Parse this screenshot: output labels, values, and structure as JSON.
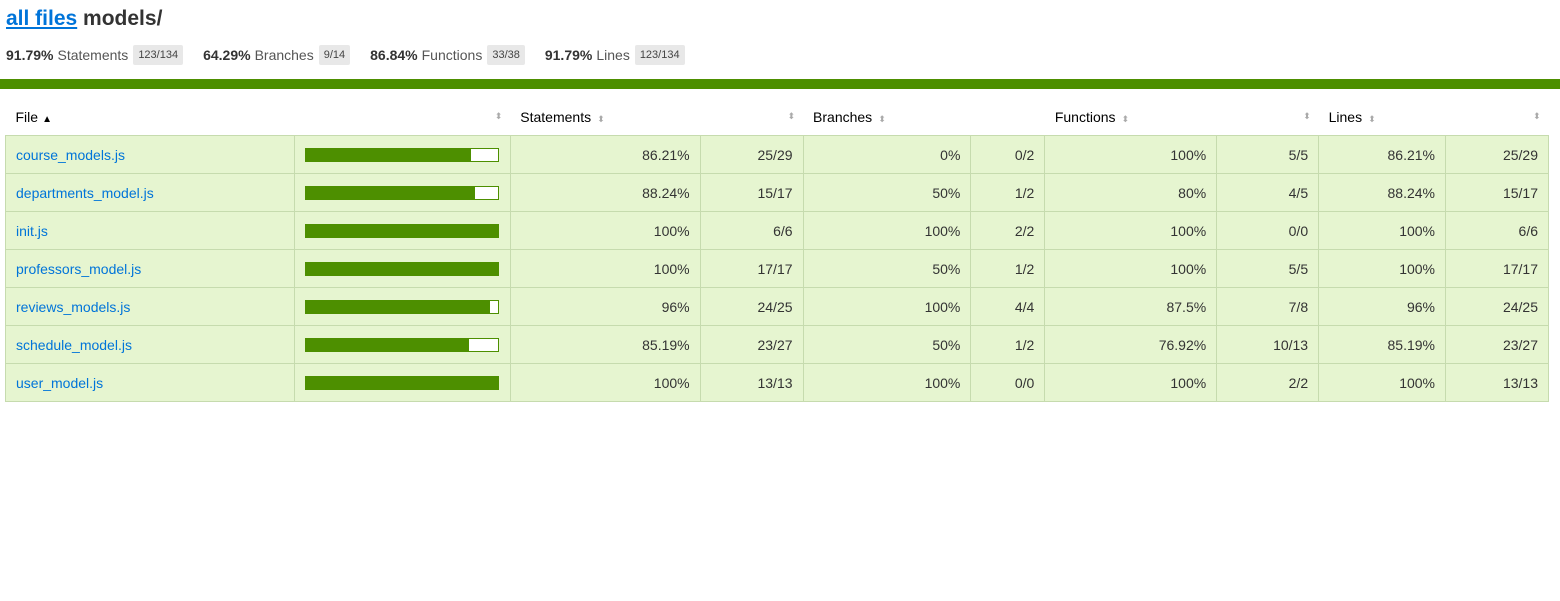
{
  "header": {
    "all_files_link": "all files",
    "current_dir": "models/"
  },
  "summary": [
    {
      "pct": "91.79%",
      "label": "Statements",
      "fraction": "123/134"
    },
    {
      "pct": "64.29%",
      "label": "Branches",
      "fraction": "9/14"
    },
    {
      "pct": "86.84%",
      "label": "Functions",
      "fraction": "33/38"
    },
    {
      "pct": "91.79%",
      "label": "Lines",
      "fraction": "123/134"
    }
  ],
  "table": {
    "headers": {
      "file": "File",
      "statements": "Statements",
      "branches": "Branches",
      "functions": "Functions",
      "lines": "Lines"
    },
    "sort_arrow": "▲",
    "sort_indicator": "⬍",
    "rows": [
      {
        "file": "course_models.js",
        "coverage": 0.8621,
        "statements_pct": "86.21%",
        "statements_frac": "25/29",
        "branches_pct": "0%",
        "branches_frac": "0/2",
        "functions_pct": "100%",
        "functions_frac": "5/5",
        "lines_pct": "86.21%",
        "lines_frac": "25/29",
        "stmt_level": "high",
        "branch_level": "low",
        "func_level": "high",
        "line_level": "high"
      },
      {
        "file": "departments_model.js",
        "coverage": 0.8824,
        "statements_pct": "88.24%",
        "statements_frac": "15/17",
        "branches_pct": "50%",
        "branches_frac": "1/2",
        "functions_pct": "80%",
        "functions_frac": "4/5",
        "lines_pct": "88.24%",
        "lines_frac": "15/17",
        "stmt_level": "high",
        "branch_level": "medium",
        "func_level": "high",
        "line_level": "high"
      },
      {
        "file": "init.js",
        "coverage": 1.0,
        "statements_pct": "100%",
        "statements_frac": "6/6",
        "branches_pct": "100%",
        "branches_frac": "2/2",
        "functions_pct": "100%",
        "functions_frac": "0/0",
        "lines_pct": "100%",
        "lines_frac": "6/6",
        "stmt_level": "high",
        "branch_level": "high",
        "func_level": "high",
        "line_level": "high"
      },
      {
        "file": "professors_model.js",
        "coverage": 1.0,
        "statements_pct": "100%",
        "statements_frac": "17/17",
        "branches_pct": "50%",
        "branches_frac": "1/2",
        "functions_pct": "100%",
        "functions_frac": "5/5",
        "lines_pct": "100%",
        "lines_frac": "17/17",
        "stmt_level": "high",
        "branch_level": "medium",
        "func_level": "high",
        "line_level": "high"
      },
      {
        "file": "reviews_models.js",
        "coverage": 0.96,
        "statements_pct": "96%",
        "statements_frac": "24/25",
        "branches_pct": "100%",
        "branches_frac": "4/4",
        "functions_pct": "87.5%",
        "functions_frac": "7/8",
        "lines_pct": "96%",
        "lines_frac": "24/25",
        "stmt_level": "high",
        "branch_level": "high",
        "func_level": "high",
        "line_level": "high"
      },
      {
        "file": "schedule_model.js",
        "coverage": 0.8519,
        "statements_pct": "85.19%",
        "statements_frac": "23/27",
        "branches_pct": "50%",
        "branches_frac": "1/2",
        "functions_pct": "76.92%",
        "functions_frac": "10/13",
        "lines_pct": "85.19%",
        "lines_frac": "23/27",
        "stmt_level": "high",
        "branch_level": "medium",
        "func_level": "medium",
        "line_level": "high"
      },
      {
        "file": "user_model.js",
        "coverage": 1.0,
        "statements_pct": "100%",
        "statements_frac": "13/13",
        "branches_pct": "100%",
        "branches_frac": "0/0",
        "functions_pct": "100%",
        "functions_frac": "2/2",
        "lines_pct": "100%",
        "lines_frac": "13/13",
        "stmt_level": "high",
        "branch_level": "high",
        "func_level": "high",
        "line_level": "high"
      }
    ]
  },
  "colors": {
    "high_bg": "#e6f5d0",
    "medium_bg": "#e8e8e8",
    "low_bg": "#fce1e5",
    "bar_fill": "#4d8f00",
    "link": "#0074D9"
  }
}
